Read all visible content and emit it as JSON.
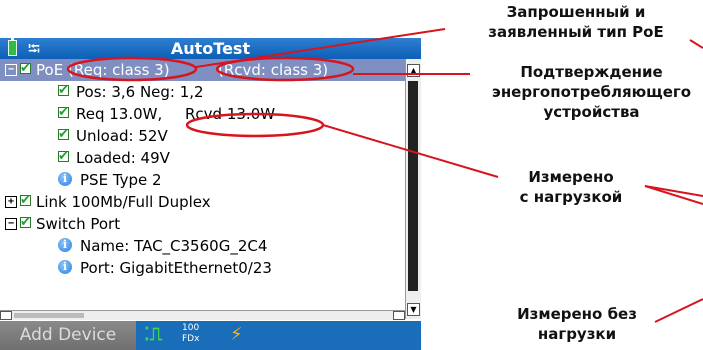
{
  "device": {
    "title": "AutoTest",
    "tree": [
      {
        "text": "PoE",
        "level": 0,
        "expander": "−",
        "check": true,
        "selected": true
      },
      {
        "text": "Pos: 3,6 Neg: 1,2",
        "level": 1,
        "check": true
      },
      {
        "text": "Req 13.0W,",
        "level": 1,
        "check": true
      },
      {
        "text": "Unload: 52V",
        "level": 1,
        "check": true
      },
      {
        "text": "Loaded: 49V",
        "level": 1,
        "check": true
      },
      {
        "text": "PSE Type 2",
        "level": 1,
        "info": true
      },
      {
        "text": "Link 100Mb/Full Duplex",
        "level": 0,
        "expander": "+",
        "check": true
      },
      {
        "text": "Switch Port",
        "level": 0,
        "expander": "−",
        "check": true
      },
      {
        "text": "Name: TAC_C3560G_2C4",
        "level": 1,
        "info": true
      },
      {
        "text": "Port: GigabitEthernet0/23",
        "level": 1,
        "info": true
      }
    ],
    "poe_req": "(Req: class 3)",
    "poe_rcvd": "(Rcvd: class 3)",
    "rcvd_power": "Rcvd 13.0W",
    "statusbar": {
      "add_device": "Add Device",
      "speed_top": "100",
      "speed_bottom": "FDx"
    }
  },
  "annotations": {
    "requested_class": "Запрошенный и\nзаявленный тип PoE",
    "pd_confirmation": "Подтверждение\nэнергопотребляющего\nустройства",
    "measured_loaded": "Измерено\nс нагрузкой",
    "measured_unloaded": "Измерено без\nнагрузки"
  },
  "colors": {
    "highlight_circle": "#d8141e",
    "title_bar": "#1a6db8",
    "selection": "#7f8fc1"
  }
}
